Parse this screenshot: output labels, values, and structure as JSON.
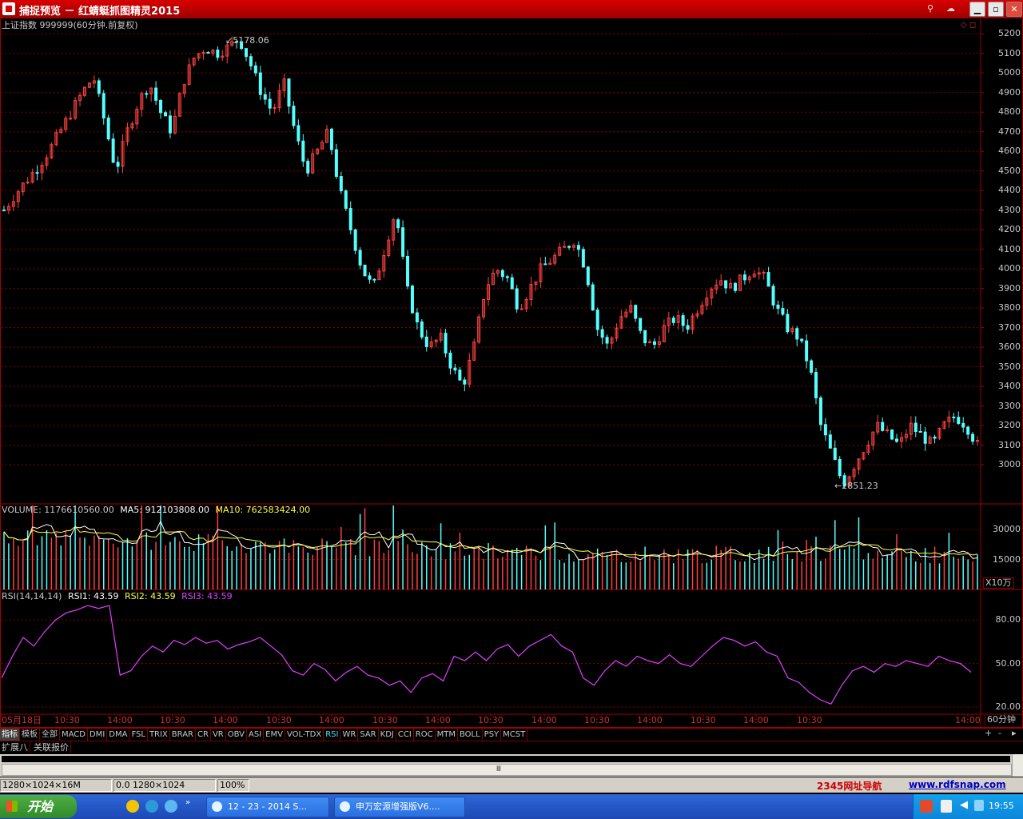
{
  "window": {
    "title": "捕捉预览 － 红蜻蜓抓图精灵2015",
    "buttons": {
      "minimize": "▁",
      "maximize": "▫",
      "close": "✕"
    }
  },
  "colors": {
    "up": "#ff4040",
    "down": "#54ffff",
    "grid": "#8a0000",
    "rsi": "#e040ff",
    "ma5": "#ffffff",
    "ma10": "#ffff40"
  },
  "main_chart": {
    "header": "上证指数 999999(60分钟.前复权)",
    "high_label": "5178.06",
    "low_label": "2851.23",
    "corner_icons": "◇ ◻"
  },
  "volume_panel": {
    "label_volume": "VOLUME: 1176610560.00",
    "label_ma5": "MA5: 912103808.00",
    "label_ma10": "MA10: 762583424.00",
    "unit": "X10万"
  },
  "rsi_panel": {
    "label_name": "RSI(14,14,14)",
    "label_rsi1": "RSI1: 43.59",
    "label_rsi2": "RSI2: 43.59",
    "label_rsi3": "RSI3: 43.59"
  },
  "x_axis": {
    "ticks": [
      "05月18日",
      "10:30",
      "14:00",
      "10:30",
      "14:00",
      "10:30",
      "14:00",
      "10:30",
      "14:00",
      "10:30",
      "14:00",
      "10:30",
      "14:00",
      "10:30",
      "14:00",
      "10:30",
      "14:00"
    ],
    "period_label": "60分钟",
    "plus": "+",
    "minus": "-",
    "nav": "▸"
  },
  "indicator_tabs": [
    "指标",
    "模板",
    "全部",
    "MACD",
    "DMI",
    "DMA",
    "FSL",
    "TRIX",
    "BRAR",
    "CR",
    "VR",
    "OBV",
    "ASI",
    "EMV",
    "VOL-TDX",
    "RSI",
    "WR",
    "SAR",
    "KDJ",
    "CCI",
    "ROC",
    "MTM",
    "BOLL",
    "PSY",
    "MCST"
  ],
  "active_tab": "指标",
  "highlight_tab": "RSI",
  "sub_tabs": [
    "扩展八",
    "关联报价"
  ],
  "scroll_handle": "Ⅲ",
  "status_bar": {
    "size": "1280×1024×16M",
    "pos": "0.0 1280×1024",
    "zoom": "100%",
    "nav_link": "2345网址导航",
    "url": "www.rdfsnap.com"
  },
  "taskbar": {
    "start": "开始",
    "tasks": [
      "12 - 23 - 2014 S...",
      "申万宏源增强版V6...."
    ],
    "time": "19:55"
  },
  "chart_data": [
    {
      "type": "candlestick",
      "title": "上证指数 999999(60分钟.前复权)",
      "ylim": [
        2800,
        5250
      ],
      "y_ticks": [
        3000,
        3100,
        3200,
        3300,
        3400,
        3500,
        3600,
        3700,
        3800,
        3900,
        4000,
        4100,
        4200,
        4300,
        4400,
        4500,
        4600,
        4700,
        4800,
        4900,
        5000,
        5100,
        5200
      ],
      "annotations": [
        {
          "text": "5178.06",
          "value": 5178.06
        },
        {
          "text": "2851.23",
          "value": 2851.23
        }
      ],
      "close": [
        4300,
        4380,
        4450,
        4520,
        4600,
        4700,
        4800,
        4900,
        4980,
        4750,
        4500,
        4700,
        4850,
        4950,
        4800,
        4700,
        4950,
        5080,
        5130,
        5100,
        5130,
        5178,
        5050,
        4900,
        4800,
        4950,
        4700,
        4500,
        4600,
        4700,
        4400,
        4200,
        4000,
        3900,
        4100,
        4300,
        3900,
        3700,
        3600,
        3650,
        3500,
        3400,
        3600,
        3900,
        4000,
        3950,
        3800,
        3900,
        4000,
        4050,
        4100,
        4150,
        4000,
        3700,
        3600,
        3750,
        3800,
        3650,
        3600,
        3700,
        3750,
        3700,
        3800,
        3900,
        3950,
        3900,
        3950,
        4000,
        3950,
        3800,
        3700,
        3650,
        3500,
        3200,
        3050,
        2900,
        3000,
        3100,
        3200,
        3150,
        3100,
        3200,
        3150,
        3100,
        3200,
        3250,
        3200,
        3100
      ],
      "grid": true
    },
    {
      "type": "bar",
      "title": "VOLUME: 1176610560.00",
      "unit": "X10万",
      "y_ticks": [
        15000,
        30000
      ],
      "ylim": [
        0,
        42000
      ],
      "series": [
        {
          "name": "MA5",
          "color": "#ffffff"
        },
        {
          "name": "MA10",
          "color": "#ffff40"
        }
      ]
    },
    {
      "type": "line",
      "title": "RSI(14,14,14)",
      "y_ticks": [
        20.0,
        50.0,
        80.0
      ],
      "ylim": [
        15,
        100
      ],
      "values": [
        40,
        55,
        68,
        62,
        72,
        80,
        85,
        87,
        90,
        88,
        90,
        42,
        45,
        55,
        62,
        58,
        66,
        63,
        68,
        64,
        66,
        60,
        63,
        65,
        68,
        62,
        56,
        45,
        42,
        50,
        46,
        38,
        44,
        48,
        42,
        40,
        35,
        38,
        30,
        40,
        43,
        38,
        55,
        52,
        58,
        52,
        60,
        63,
        55,
        62,
        66,
        70,
        62,
        58,
        40,
        35,
        45,
        52,
        48,
        55,
        52,
        50,
        56,
        50,
        48,
        55,
        62,
        68,
        66,
        62,
        65,
        58,
        55,
        40,
        37,
        30,
        25,
        22,
        35,
        45,
        48,
        44,
        50,
        48,
        52,
        50,
        48,
        55,
        52,
        50,
        44
      ]
    }
  ]
}
